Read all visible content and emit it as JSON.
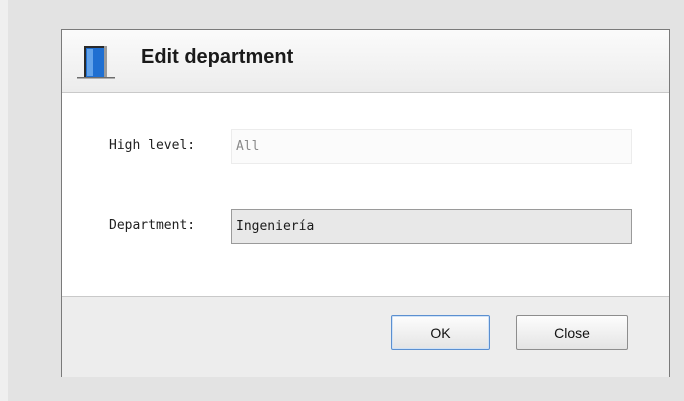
{
  "dialog": {
    "title": "Edit department",
    "icon": "door-icon"
  },
  "form": {
    "high_level": {
      "label": "High level:",
      "value": "All"
    },
    "department": {
      "label": "Department:",
      "value": "Ingeniería"
    }
  },
  "buttons": {
    "ok_label": "OK",
    "close_label": "Close"
  },
  "colors": {
    "icon_blue": "#1f6fd1",
    "ok_focus_border": "#5b8fd0"
  }
}
